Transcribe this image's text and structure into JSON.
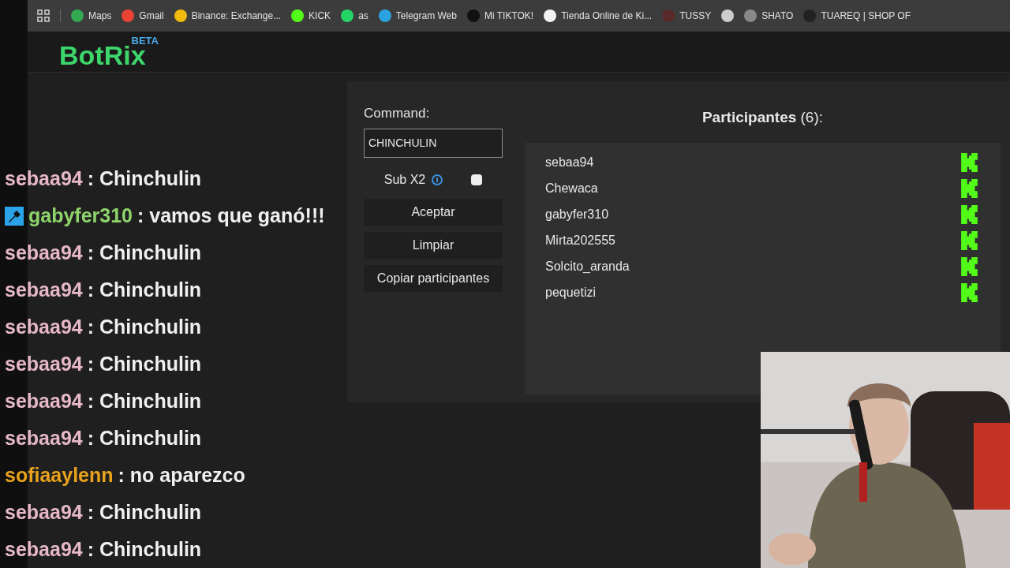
{
  "bookmarks": [
    {
      "label": "Maps",
      "color": "#34a853"
    },
    {
      "label": "Gmail",
      "color": "#ea4335"
    },
    {
      "label": "Binance: Exchange...",
      "color": "#f0b90b"
    },
    {
      "label": "KICK",
      "color": "#53fc18"
    },
    {
      "label": "as",
      "color": "#25d366"
    },
    {
      "label": "Telegram Web",
      "color": "#2aa3e0"
    },
    {
      "label": "Mi TIKTOK!",
      "color": "#111111"
    },
    {
      "label": "Tienda Online de Ki...",
      "color": "#f2f2f2"
    },
    {
      "label": "TUSSY",
      "color": "#5a2a2a"
    },
    {
      "color": "#cccccc"
    },
    {
      "label": "SHATO",
      "color": "#888888"
    },
    {
      "label": "TUAREQ | SHOP OF",
      "color": "#222222"
    }
  ],
  "logo": {
    "name": "BotRix",
    "tag": "BETA"
  },
  "command": {
    "label": "Command:",
    "value": "CHINCHULIN"
  },
  "sub_x2": {
    "label": "Sub X2",
    "checked": false
  },
  "buttons": [
    "Aceptar",
    "Limpiar",
    "Copiar participantes"
  ],
  "participants": {
    "title": "Participantes",
    "count": "(6):",
    "items": [
      "sebaa94",
      "Chewaca",
      "gabyfer310",
      "Mirta202555",
      "Solcito_aranda",
      "pequetizi"
    ]
  },
  "chat": [
    {
      "user": "sebaa94",
      "text": ": Chinchulin",
      "color": "#e6b8c6",
      "moderator": false
    },
    {
      "user": "gabyfer310",
      "text": ": vamos que ganó!!!",
      "color": "#8ed46b",
      "moderator": true
    },
    {
      "user": "sebaa94",
      "text": ": Chinchulin",
      "color": "#e6b8c6",
      "moderator": false
    },
    {
      "user": "sebaa94",
      "text": ": Chinchulin",
      "color": "#e6b8c6",
      "moderator": false
    },
    {
      "user": "sebaa94",
      "text": ": Chinchulin",
      "color": "#e6b8c6",
      "moderator": false
    },
    {
      "user": "sebaa94",
      "text": ": Chinchulin",
      "color": "#e6b8c6",
      "moderator": false
    },
    {
      "user": "sebaa94",
      "text": ": Chinchulin",
      "color": "#e6b8c6",
      "moderator": false
    },
    {
      "user": "sebaa94",
      "text": ": Chinchulin",
      "color": "#e6b8c6",
      "moderator": false
    },
    {
      "user": "sofiaaylenn",
      "text": ": no aparezco",
      "color": "#e9a21c",
      "moderator": false
    },
    {
      "user": "sebaa94",
      "text": ": Chinchulin",
      "color": "#e6b8c6",
      "moderator": false
    },
    {
      "user": "sebaa94",
      "text": ": Chinchulin",
      "color": "#e6b8c6",
      "moderator": false
    }
  ]
}
